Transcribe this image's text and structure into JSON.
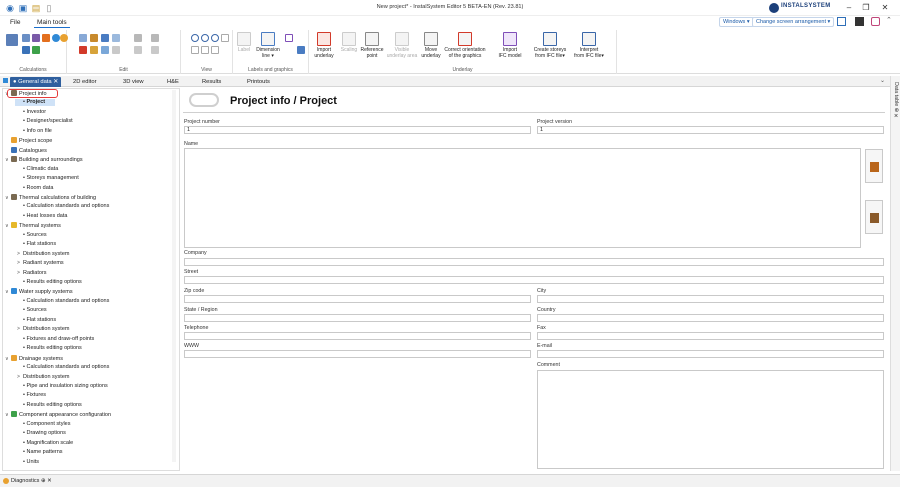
{
  "window": {
    "title": "New project* - InstalSystem Editor 5 BETA-EN (Rev. 23.81)",
    "brand": "INSTALSYSTEM",
    "controls": {
      "min": "–",
      "max": "❐",
      "close": "✕"
    }
  },
  "menubar": {
    "file": "File",
    "main_tools": "Main tools"
  },
  "topright": {
    "windows": "Windows ▾",
    "arrangement": "Change screen arrangement ▾"
  },
  "ribbon": {
    "groups": {
      "calculations": "Calculations",
      "edit": "Edit",
      "view": "View",
      "labels": "Labels and graphics",
      "underlay": "Underlay"
    },
    "labels_buttons": {
      "label": "Label",
      "dimension": "Dimension\nline ▾"
    },
    "underlay_buttons": {
      "import_underlay": "Import\nunderlay",
      "scaling": "Scaling",
      "reference": "Reference\npoint",
      "visible_area": "Visible\nunderlay area",
      "move_underlay": "Move\nunderlay",
      "correct_orientation": "Correct orientation\nof the graphics",
      "import_ifc": "Import\nIFC model",
      "create_storeys": "Create storeys\nfrom IFC file▾",
      "interpret": "Interpret\nfrom IFC file▾"
    }
  },
  "tabs": [
    "● General data ✕",
    "2D editor",
    "3D view",
    "H&E",
    "Results",
    "Printouts"
  ],
  "tree": [
    {
      "label": "Project info",
      "level": 0,
      "twisty": "∨",
      "icon": "folder-icon"
    },
    {
      "label": "Project",
      "level": 1,
      "bullet": true,
      "selected": true
    },
    {
      "label": "Investor",
      "level": 1,
      "bullet": true
    },
    {
      "label": "Designer/specialist",
      "level": 1,
      "bullet": true
    },
    {
      "label": "Info on file",
      "level": 1,
      "bullet": true
    },
    {
      "label": "Project scope",
      "level": 0,
      "icon": "scope-icon"
    },
    {
      "label": "Catalogues",
      "level": 0,
      "icon": "catalogue-icon"
    },
    {
      "label": "Building and surroundings",
      "level": 0,
      "twisty": "∨",
      "icon": "building-icon"
    },
    {
      "label": "Climatic data",
      "level": 1,
      "bullet": true
    },
    {
      "label": "Storeys management",
      "level": 1,
      "bullet": true
    },
    {
      "label": "Room data",
      "level": 1,
      "bullet": true
    },
    {
      "label": "Thermal calculations of building",
      "level": 0,
      "twisty": "∨",
      "icon": "thermal-calc-icon"
    },
    {
      "label": "Calculation standards and options",
      "level": 1,
      "bullet": true
    },
    {
      "label": "Heat losses data",
      "level": 1,
      "bullet": true
    },
    {
      "label": "Thermal systems",
      "level": 0,
      "twisty": "∨",
      "icon": "thermal-system-icon"
    },
    {
      "label": "Sources",
      "level": 1,
      "bullet": true
    },
    {
      "label": "Flat stations",
      "level": 1,
      "bullet": true
    },
    {
      "label": "Distribution system",
      "level": 1,
      "twisty": ">"
    },
    {
      "label": "Radiant systems",
      "level": 1,
      "twisty": ">"
    },
    {
      "label": "Radiators",
      "level": 1,
      "twisty": ">"
    },
    {
      "label": "Results editing options",
      "level": 1,
      "bullet": true
    },
    {
      "label": "Water supply systems",
      "level": 0,
      "twisty": "∨",
      "icon": "water-drop-icon"
    },
    {
      "label": "Calculation standards and options",
      "level": 1,
      "bullet": true
    },
    {
      "label": "Sources",
      "level": 1,
      "bullet": true
    },
    {
      "label": "Flat stations",
      "level": 1,
      "bullet": true
    },
    {
      "label": "Distribution system",
      "level": 1,
      "twisty": ">"
    },
    {
      "label": "Fixtures and draw-off points",
      "level": 1,
      "bullet": true
    },
    {
      "label": "Results editing options",
      "level": 1,
      "bullet": true
    },
    {
      "label": "Drainage systems",
      "level": 0,
      "twisty": "∨",
      "icon": "drainage-icon"
    },
    {
      "label": "Calculation standards and options",
      "level": 1,
      "bullet": true
    },
    {
      "label": "Distribution system",
      "level": 1,
      "twisty": ">"
    },
    {
      "label": "Pipe and insulation sizing options",
      "level": 1,
      "bullet": true
    },
    {
      "label": "Fixtures",
      "level": 1,
      "bullet": true
    },
    {
      "label": "Results editing options",
      "level": 1,
      "bullet": true
    },
    {
      "label": "Component appearance configuration",
      "level": 0,
      "twisty": "∨",
      "icon": "appearance-icon"
    },
    {
      "label": "Component styles",
      "level": 1,
      "bullet": true
    },
    {
      "label": "Drawing options",
      "level": 1,
      "bullet": true
    },
    {
      "label": "Magnification scale",
      "level": 1,
      "bullet": true
    },
    {
      "label": "Name patterns",
      "level": 1,
      "bullet": true
    },
    {
      "label": "Units",
      "level": 1,
      "bullet": true
    }
  ],
  "page": {
    "title": "Project info / Project",
    "fields": {
      "project_number_label": "Project number",
      "project_number": "1",
      "project_version_label": "Project version",
      "project_version": "1",
      "name_label": "Name",
      "company_label": "Company",
      "street_label": "Street",
      "zip_label": "Zip code",
      "city_label": "City",
      "state_label": "State / Region",
      "country_label": "Country",
      "telephone_label": "Telephone",
      "fax_label": "Fax",
      "www_label": "WWW",
      "email_label": "E-mail",
      "comment_label": "Comment"
    }
  },
  "side_panel": {
    "label": "Data table ⊕ ✕"
  },
  "diagnostics": {
    "label": "Diagnostics ⊕ ✕"
  },
  "colors": {
    "accent": "#2f5f9e",
    "highlight": "#e43a3a"
  }
}
